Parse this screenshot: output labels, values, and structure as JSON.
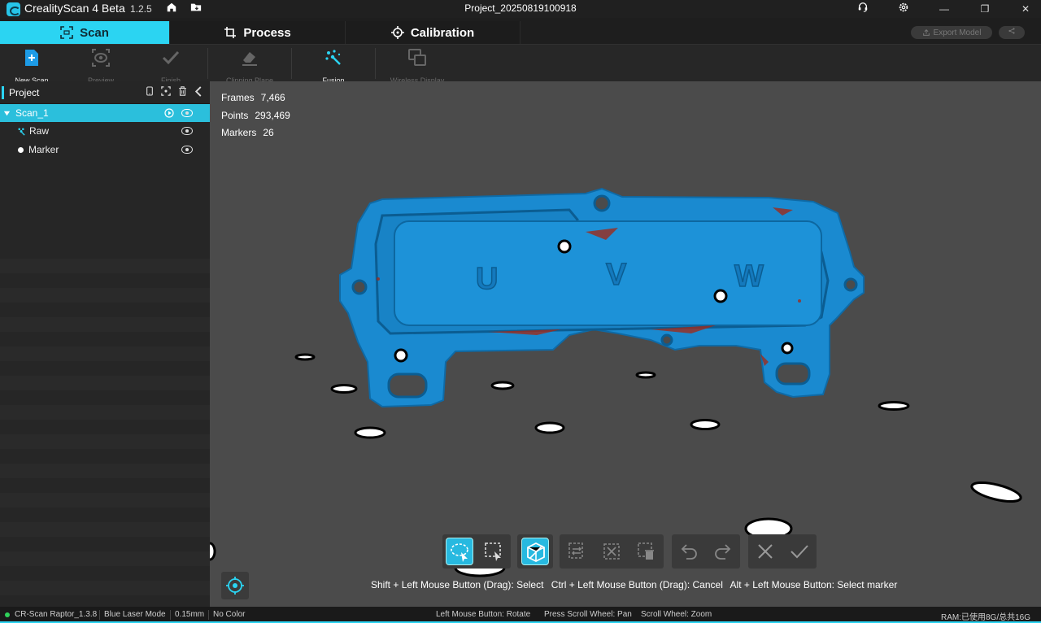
{
  "app": {
    "name": "CrealityScan 4 Beta",
    "version": "1.2.5",
    "window_title": "Project_20250819100918"
  },
  "tabs": [
    {
      "label": "Scan",
      "active": true
    },
    {
      "label": "Process",
      "active": false
    },
    {
      "label": "Calibration",
      "active": false
    }
  ],
  "actions": {
    "export_label": "Export Model"
  },
  "toolbar": {
    "new_scan": "New Scan",
    "preview": "Preview",
    "finish": "Finish",
    "clipping_plane": "Clipping Plane",
    "fusion": "Fusion",
    "wireless_display": "Wireless Display"
  },
  "sidebar": {
    "title": "Project",
    "items": [
      {
        "label": "Scan_1"
      },
      {
        "label": "Raw"
      },
      {
        "label": "Marker"
      }
    ]
  },
  "stats": {
    "frames_label": "Frames",
    "frames_value": "7,466",
    "points_label": "Points",
    "points_value": "293,469",
    "markers_label": "Markers",
    "markers_value": "26"
  },
  "model": {
    "letters": [
      "U",
      "V",
      "W"
    ],
    "color": "#1a8ad0"
  },
  "hints": {
    "shift": "Shift + Left Mouse Button (Drag): Select",
    "ctrl": "Ctrl + Left Mouse Button (Drag): Cancel",
    "alt": "Alt + Left Mouse Button: Select marker"
  },
  "statusbar": {
    "device": "CR-Scan Raptor_1.3.8",
    "mode": "Blue Laser Mode",
    "resolution": "0.15mm",
    "color": "No Color",
    "rotate": "Left Mouse Button: Rotate",
    "pan": "Press Scroll Wheel: Pan",
    "zoom": "Scroll Wheel: Zoom",
    "ram": "RAM:已使用8G/总共16G"
  },
  "colors": {
    "accent": "#2bd4f2",
    "viewport_bg": "#4b4b4b",
    "status_ok": "#2fd25a"
  }
}
